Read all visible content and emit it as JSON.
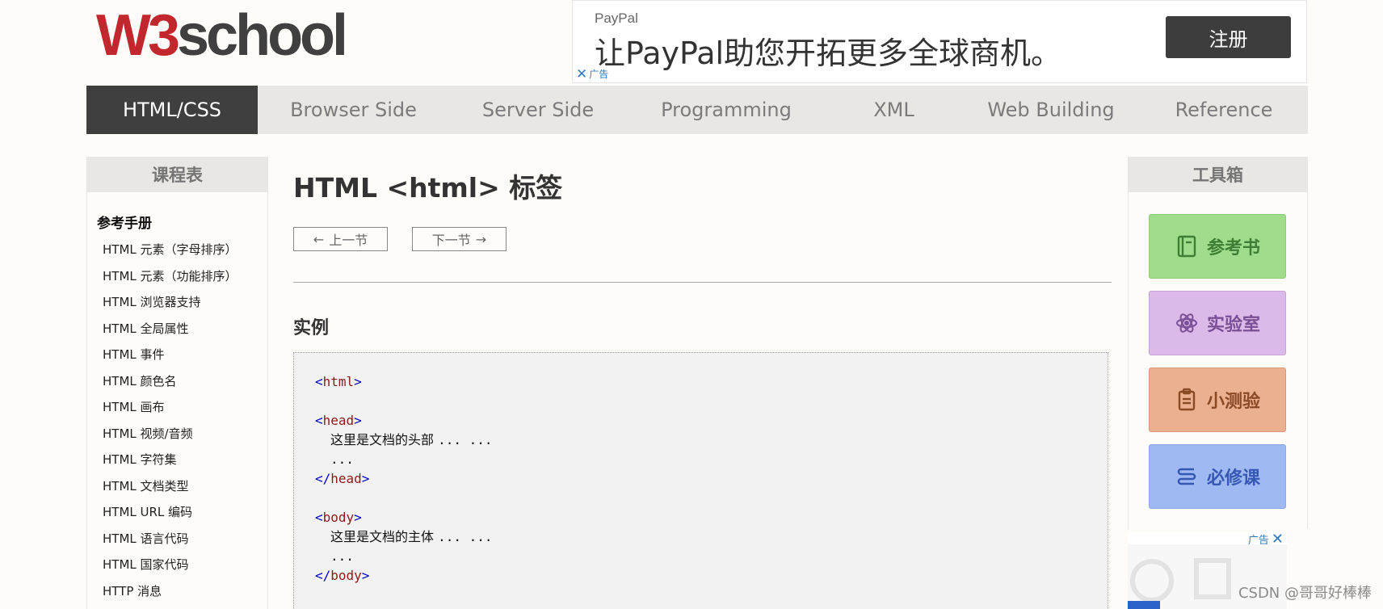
{
  "header": {
    "logo": {
      "w3": "W3",
      "school": "school"
    },
    "ad": {
      "brand": "PayPal",
      "text": "让PayPal助您开拓更多全球商机。",
      "button": "注册",
      "close_label": "广告"
    }
  },
  "nav": {
    "items": [
      "HTML/CSS",
      "Browser Side",
      "Server Side",
      "Programming",
      "XML",
      "Web Building",
      "Reference"
    ],
    "active": "HTML/CSS"
  },
  "left_sidebar": {
    "title": "课程表",
    "heading": "参考手册",
    "items": [
      "HTML 元素（字母排序）",
      "HTML 元素（功能排序）",
      "HTML 浏览器支持",
      "HTML 全局属性",
      "HTML 事件",
      "HTML 颜色名",
      "HTML 画布",
      "HTML 视频/音频",
      "HTML 字符集",
      "HTML 文档类型",
      "HTML URL 编码",
      "HTML 语言代码",
      "HTML 国家代码",
      "HTTP 消息"
    ]
  },
  "main": {
    "title": "HTML <html> 标签",
    "prev_label": "上一节",
    "next_label": "下一节",
    "example_heading": "实例",
    "code": {
      "html": "html",
      "head": "head",
      "head_text": "这里是文档的头部",
      "body": "body",
      "body_text": "这里是文档的主体",
      "ellipsis": "... ...",
      "ellipsis2": "..."
    }
  },
  "right_sidebar": {
    "title": "工具箱",
    "tools": [
      "参考书",
      "实验室",
      "小测验",
      "必修课"
    ]
  },
  "ad_bottom": {
    "label": "广告"
  },
  "watermark": "CSDN @哥哥好棒棒",
  "colors": {
    "nav_active_bg": "#3f3f3f",
    "nav_bg": "#e8e7e3",
    "logo_red": "#c1272d",
    "tool_ref": "#9fdd8d",
    "tool_lab": "#dbb9e8",
    "tool_quiz": "#eab090",
    "tool_course": "#9fb9f3"
  }
}
